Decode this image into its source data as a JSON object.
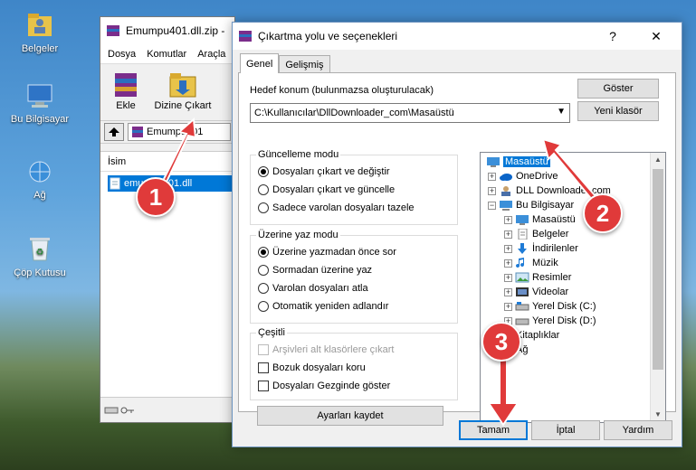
{
  "desktop": {
    "icons": [
      {
        "label": "Belgeler"
      },
      {
        "label": "Bu Bilgisayar"
      },
      {
        "label": "Ağ"
      },
      {
        "label": "Çöp Kutusu"
      }
    ]
  },
  "rar": {
    "title": "Emumpu401.dll.zip -",
    "menu": [
      "Dosya",
      "Komutlar",
      "Araçla"
    ],
    "toolbar": {
      "add": "Ekle",
      "extract": "Dizine Çıkart"
    },
    "address": "Emumpu401",
    "column_name": "İsim",
    "file": "emumpu401.dll"
  },
  "dialog": {
    "title": "Çıkartma yolu ve seçenekleri",
    "help_glyph": "?",
    "close_glyph": "✕",
    "tabs": [
      "Genel",
      "Gelişmiş"
    ],
    "dest_label": "Hedef konum (bulunmazsa oluşturulacak)",
    "dest_value": "C:\\Kullanıcılar\\DllDownloader_com\\Masaüstü",
    "show_button": "Göster",
    "new_folder_button": "Yeni klasör",
    "update_group": {
      "title": "Güncelleme modu",
      "options": [
        "Dosyaları çıkart ve değiştir",
        "Dosyaları çıkart ve güncelle",
        "Sadece varolan dosyaları tazele"
      ],
      "selected": 0
    },
    "overwrite_group": {
      "title": "Üzerine yaz modu",
      "options": [
        "Üzerine yazmadan önce sor",
        "Sormadan üzerine yaz",
        "Varolan dosyaları atla",
        "Otomatik yeniden adlandır"
      ],
      "selected": 0
    },
    "misc_group": {
      "title": "Çeşitli",
      "options": [
        "Arşivleri alt klasörlere çıkart",
        "Bozuk dosyaları koru",
        "Dosyaları Gezginde göster"
      ]
    },
    "save_settings": "Ayarları kaydet",
    "tree": [
      {
        "label": "Masaüstü",
        "icon": "desktop-icon",
        "level": 0,
        "selected": true
      },
      {
        "label": "OneDrive",
        "icon": "onedrive-icon",
        "level": 1
      },
      {
        "label": "DLL Downloader.com",
        "icon": "user-icon",
        "level": 1
      },
      {
        "label": "Bu Bilgisayar",
        "icon": "computer-icon",
        "level": 1
      },
      {
        "label": "Masaüstü",
        "icon": "desktop-icon",
        "level": 2
      },
      {
        "label": "Belgeler",
        "icon": "documents-icon",
        "level": 2
      },
      {
        "label": "İndirilenler",
        "icon": "downloads-icon",
        "level": 2
      },
      {
        "label": "Müzik",
        "icon": "music-icon",
        "level": 2
      },
      {
        "label": "Resimler",
        "icon": "pictures-icon",
        "level": 2
      },
      {
        "label": "Videolar",
        "icon": "videos-icon",
        "level": 2
      },
      {
        "label": "Yerel Disk (C:)",
        "icon": "disk-icon",
        "level": 2
      },
      {
        "label": "Yerel Disk (D:)",
        "icon": "disk-icon",
        "level": 2
      },
      {
        "label": "Kitaplıklar",
        "icon": "libraries-icon",
        "level": 1
      },
      {
        "label": "Ağ",
        "icon": "network-icon",
        "level": 1
      }
    ],
    "ok": "Tamam",
    "cancel": "İptal",
    "help": "Yardım"
  },
  "annotations": {
    "steps": [
      "1",
      "2",
      "3"
    ],
    "color": "#e03a3a"
  }
}
